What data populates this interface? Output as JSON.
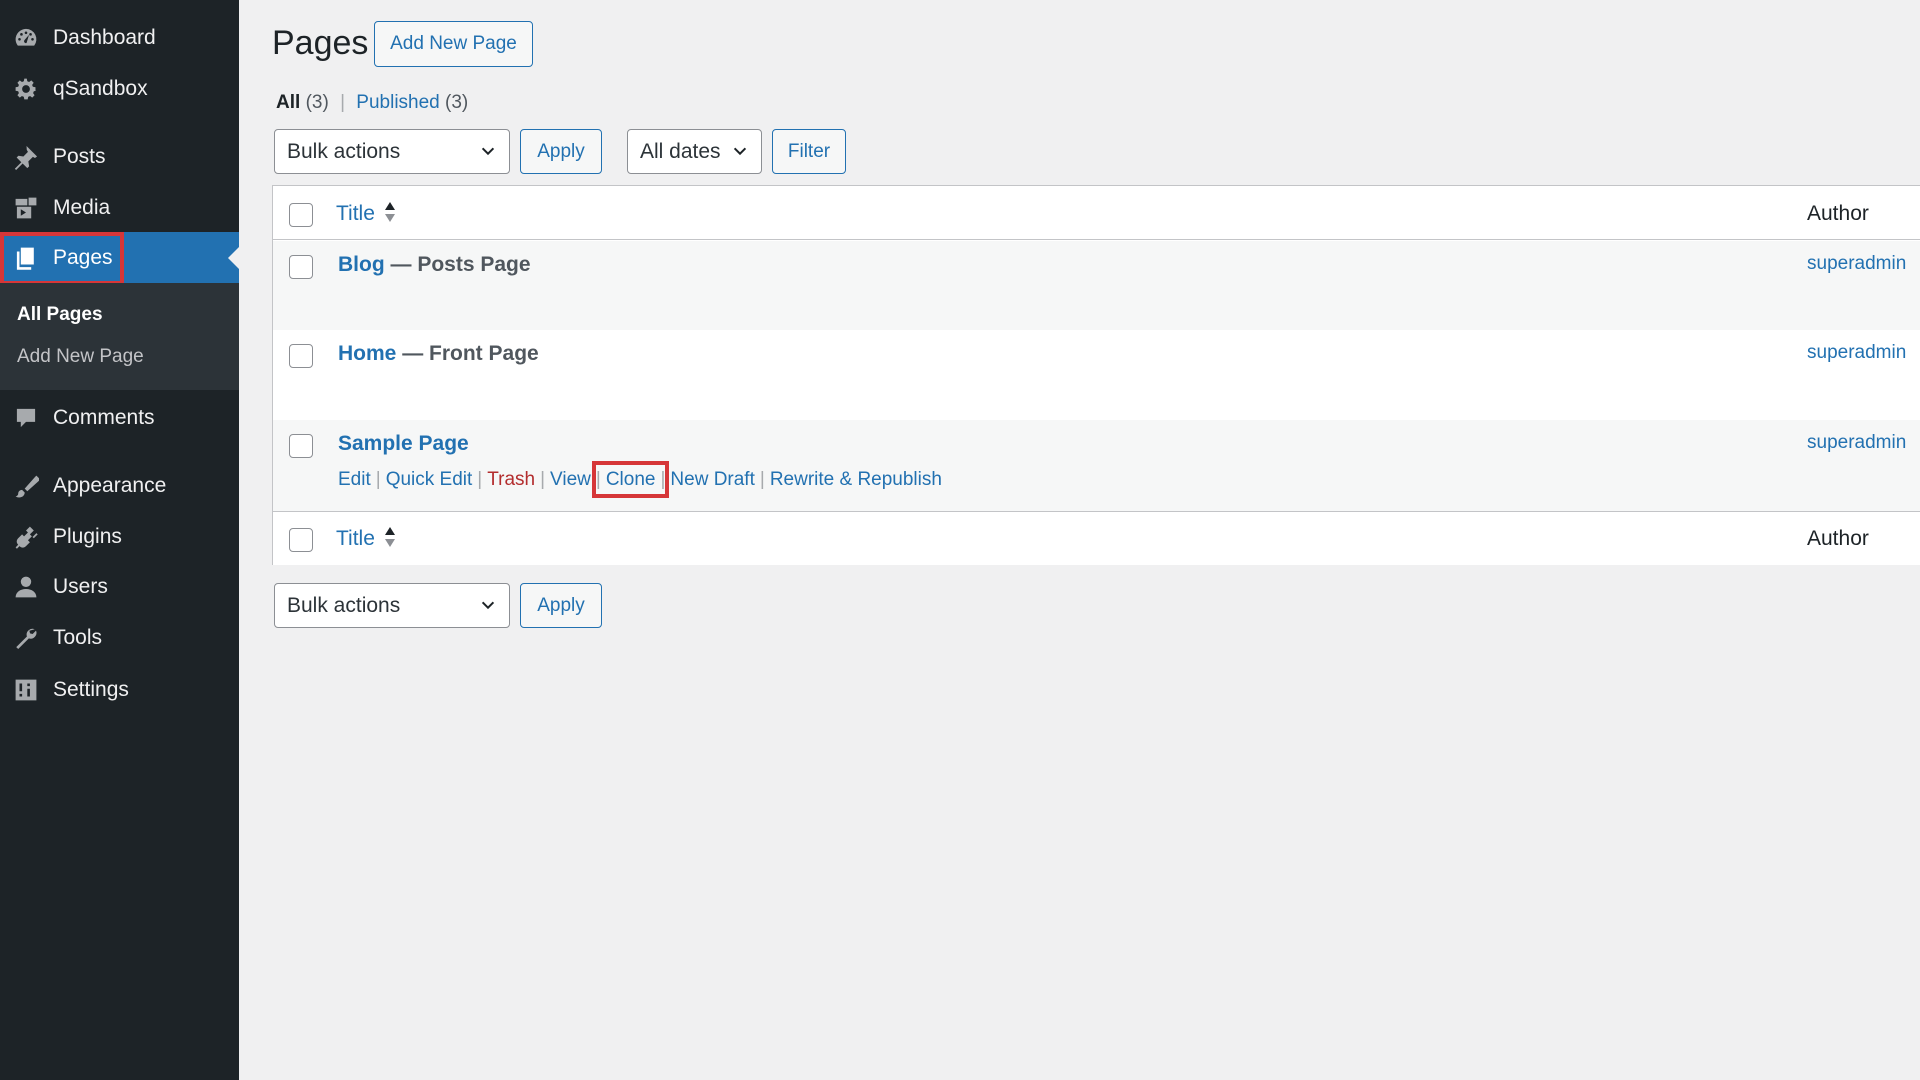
{
  "sidebar": {
    "items": [
      {
        "label": "Dashboard",
        "icon": "dashboard-icon"
      },
      {
        "label": "qSandbox",
        "icon": "gear-icon"
      },
      {
        "label": "Posts",
        "icon": "pushpin-icon"
      },
      {
        "label": "Media",
        "icon": "media-icon"
      },
      {
        "label": "Pages",
        "icon": "pages-icon"
      },
      {
        "label": "Comments",
        "icon": "comment-icon"
      },
      {
        "label": "Appearance",
        "icon": "paintbrush-icon"
      },
      {
        "label": "Plugins",
        "icon": "plug-icon"
      },
      {
        "label": "Users",
        "icon": "user-icon"
      },
      {
        "label": "Tools",
        "icon": "wrench-icon"
      },
      {
        "label": "Settings",
        "icon": "settings-sliders-icon"
      }
    ],
    "submenu": [
      {
        "label": "All Pages"
      },
      {
        "label": "Add New Page"
      }
    ]
  },
  "header": {
    "title": "Pages",
    "add_new_label": "Add New Page"
  },
  "views": {
    "all_label": "All",
    "all_count": "(3)",
    "separator": "|",
    "published_label": "Published",
    "published_count": "(3)"
  },
  "top_nav": {
    "bulk_actions": "Bulk actions",
    "apply_label": "Apply",
    "dates_filter": "All dates",
    "filter_label": "Filter"
  },
  "bottom_nav": {
    "bulk_actions": "Bulk actions",
    "apply_label": "Apply"
  },
  "table": {
    "columns": {
      "title": "Title",
      "author": "Author"
    },
    "rows": [
      {
        "title": "Blog",
        "state": " — Posts Page",
        "author": "superadmin"
      },
      {
        "title": "Home",
        "state": " — Front Page",
        "author": "superadmin"
      },
      {
        "title": "Sample Page",
        "state": "",
        "author": "superadmin"
      }
    ],
    "row_actions": {
      "edit": "Edit",
      "quick_edit": "Quick Edit",
      "trash": "Trash",
      "view": "View",
      "clone": "Clone",
      "new_draft": "New Draft",
      "rewrite_republish": "Rewrite & Republish"
    },
    "row_action_separator": "|"
  },
  "colors": {
    "sidebar_bg": "#1d2327",
    "active_menu": "#2271b1",
    "link": "#2271b1",
    "trash": "#b32d2e",
    "highlight": "#d63638"
  }
}
